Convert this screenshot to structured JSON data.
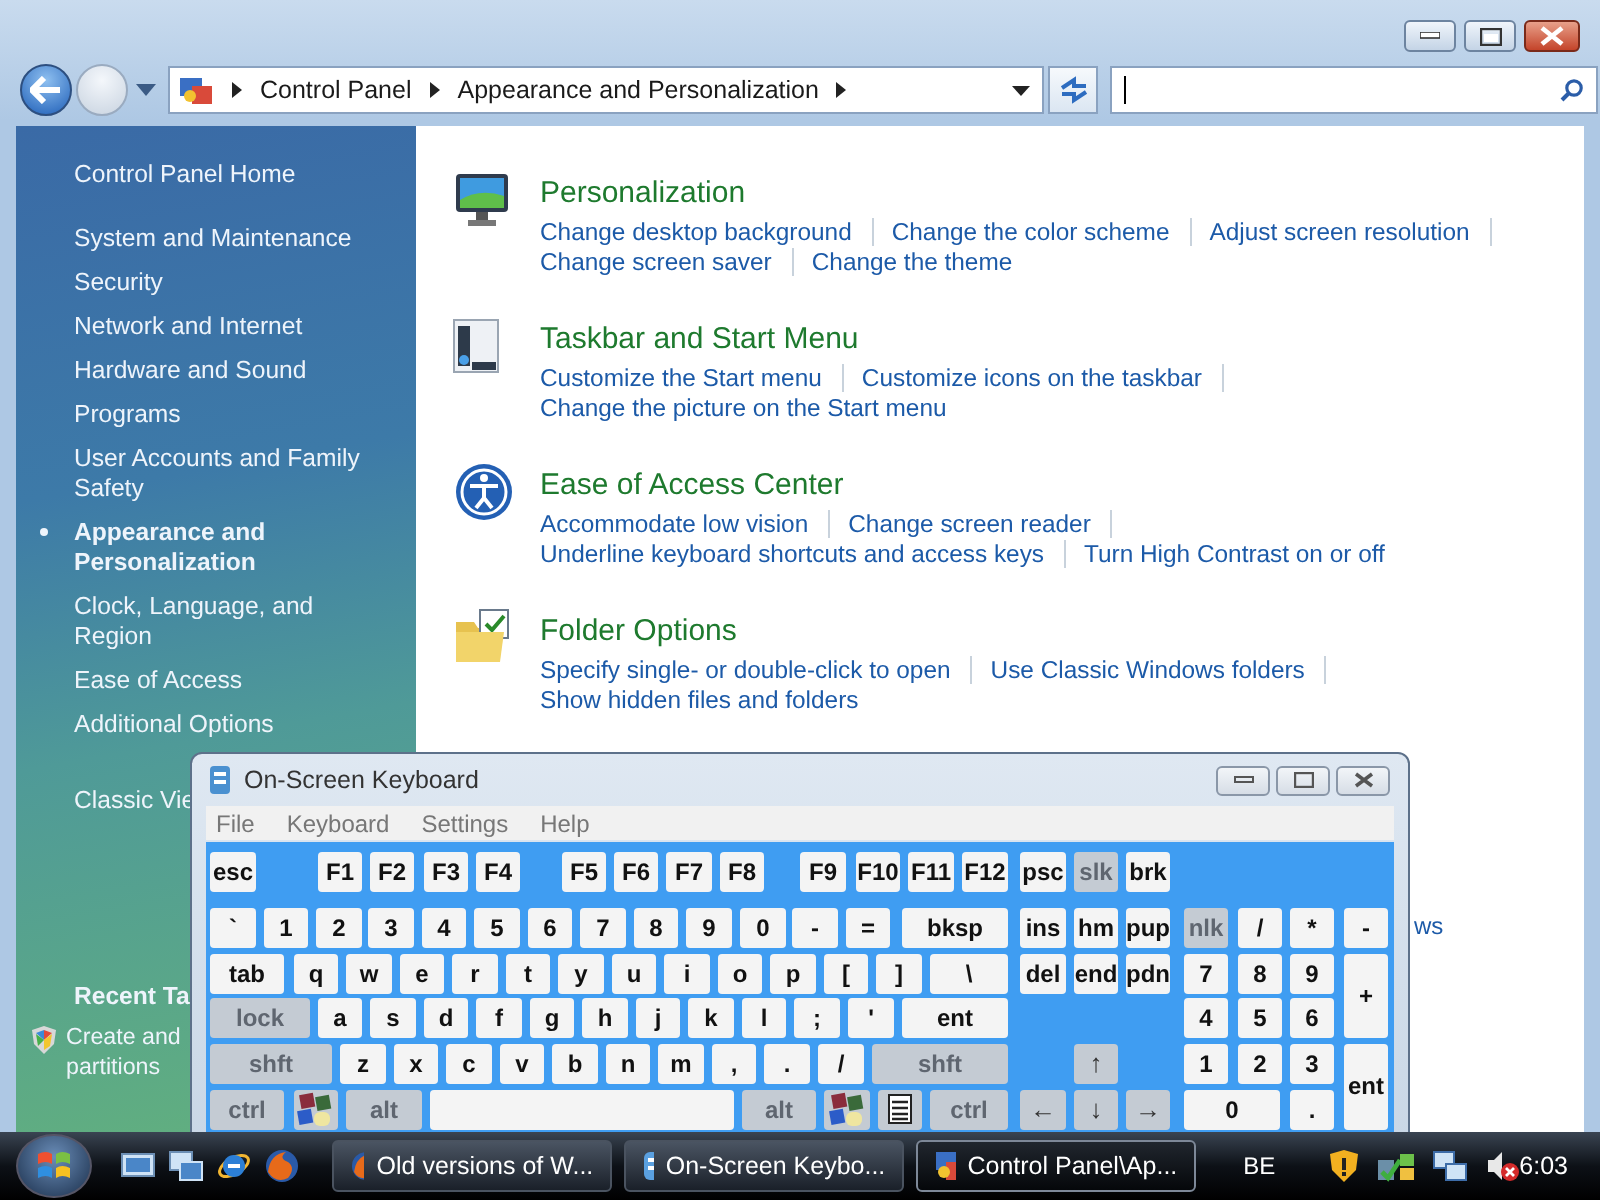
{
  "navigation": {
    "back": {
      "disabled": false
    },
    "forward": {
      "disabled": true
    }
  },
  "address_bar": {
    "crumbs": [
      "Control Panel",
      "Appearance and Personalization"
    ]
  },
  "sidebar": {
    "home": "Control Panel Home",
    "categories": [
      {
        "label": "System and Maintenance",
        "selected": false
      },
      {
        "label": "Security",
        "selected": false
      },
      {
        "label": "Network and Internet",
        "selected": false
      },
      {
        "label": "Hardware and Sound",
        "selected": false
      },
      {
        "label": "Programs",
        "selected": false
      },
      {
        "label": "User Accounts and Family Safety",
        "selected": false
      },
      {
        "label": "Appearance and Personalization",
        "selected": true
      },
      {
        "label": "Clock, Language, and Region",
        "selected": false
      },
      {
        "label": "Ease of Access",
        "selected": false
      },
      {
        "label": "Additional Options",
        "selected": false
      }
    ],
    "other_link": "Classic Vie",
    "recent_tasks": {
      "title": "Recent Ta",
      "items": [
        "Create and partitions"
      ]
    }
  },
  "categories": [
    {
      "title": "Personalization",
      "link_rows": [
        [
          "Change desktop background",
          "Change the color scheme",
          "Adjust screen resolution"
        ],
        [
          "Change screen saver",
          "Change the theme"
        ]
      ]
    },
    {
      "title": "Taskbar and Start Menu",
      "link_rows": [
        [
          "Customize the Start menu",
          "Customize icons on the taskbar"
        ],
        [
          "Change the picture on the Start menu"
        ]
      ]
    },
    {
      "title": "Ease of Access Center",
      "link_rows": [
        [
          "Accommodate low vision",
          "Change screen reader"
        ],
        [
          "Underline keyboard shortcuts and access keys",
          "Turn High Contrast on or off"
        ]
      ]
    },
    {
      "title": "Folder Options",
      "link_rows": [
        [
          "Specify single- or double-click to open",
          "Use Classic Windows folders"
        ],
        [
          "Show hidden files and folders"
        ]
      ]
    }
  ],
  "hidden_link_fragment": "ws",
  "keyboard": {
    "title": "On-Screen Keyboard",
    "menu": [
      "File",
      "Keyboard",
      "Settings",
      "Help"
    ],
    "rows": [
      {
        "keys": [
          {
            "label": "esc",
            "kind": "key"
          },
          {
            "label": "F1",
            "kind": "key"
          },
          {
            "label": "F2",
            "kind": "key"
          },
          {
            "label": "F3",
            "kind": "key"
          },
          {
            "label": "F4",
            "kind": "key"
          },
          {
            "label": "F5",
            "kind": "key"
          },
          {
            "label": "F6",
            "kind": "key"
          },
          {
            "label": "F7",
            "kind": "key"
          },
          {
            "label": "F8",
            "kind": "key"
          },
          {
            "label": "F9",
            "kind": "key"
          },
          {
            "label": "F10",
            "kind": "key"
          },
          {
            "label": "F11",
            "kind": "key"
          },
          {
            "label": "F12",
            "kind": "key"
          },
          {
            "label": "psc",
            "kind": "key"
          },
          {
            "label": "slk",
            "kind": "modifier"
          },
          {
            "label": "brk",
            "kind": "key"
          }
        ]
      },
      {
        "keys": [
          {
            "label": "`",
            "kind": "key"
          },
          {
            "label": "1",
            "kind": "key"
          },
          {
            "label": "2",
            "kind": "key"
          },
          {
            "label": "3",
            "kind": "key"
          },
          {
            "label": "4",
            "kind": "key"
          },
          {
            "label": "5",
            "kind": "key"
          },
          {
            "label": "6",
            "kind": "key"
          },
          {
            "label": "7",
            "kind": "key"
          },
          {
            "label": "8",
            "kind": "key"
          },
          {
            "label": "9",
            "kind": "key"
          },
          {
            "label": "0",
            "kind": "key"
          },
          {
            "label": "-",
            "kind": "key"
          },
          {
            "label": "=",
            "kind": "key"
          },
          {
            "label": "bksp",
            "kind": "key"
          },
          {
            "label": "ins",
            "kind": "key"
          },
          {
            "label": "hm",
            "kind": "key"
          },
          {
            "label": "pup",
            "kind": "key"
          },
          {
            "label": "nlk",
            "kind": "modifier"
          },
          {
            "label": "/",
            "kind": "key"
          },
          {
            "label": "*",
            "kind": "key"
          },
          {
            "label": "-",
            "kind": "key"
          }
        ]
      },
      {
        "keys": [
          {
            "label": "tab",
            "kind": "key"
          },
          {
            "label": "q",
            "kind": "key"
          },
          {
            "label": "w",
            "kind": "key"
          },
          {
            "label": "e",
            "kind": "key"
          },
          {
            "label": "r",
            "kind": "key"
          },
          {
            "label": "t",
            "kind": "key"
          },
          {
            "label": "y",
            "kind": "key"
          },
          {
            "label": "u",
            "kind": "key"
          },
          {
            "label": "i",
            "kind": "key"
          },
          {
            "label": "o",
            "kind": "key"
          },
          {
            "label": "p",
            "kind": "key"
          },
          {
            "label": "[",
            "kind": "key"
          },
          {
            "label": "]",
            "kind": "key"
          },
          {
            "label": "\\",
            "kind": "key"
          },
          {
            "label": "del",
            "kind": "key"
          },
          {
            "label": "end",
            "kind": "key"
          },
          {
            "label": "pdn",
            "kind": "key"
          },
          {
            "label": "7",
            "kind": "key"
          },
          {
            "label": "8",
            "kind": "key"
          },
          {
            "label": "9",
            "kind": "key"
          },
          {
            "label": "+",
            "kind": "key"
          }
        ]
      },
      {
        "keys": [
          {
            "label": "lock",
            "kind": "modifier"
          },
          {
            "label": "a",
            "kind": "key"
          },
          {
            "label": "s",
            "kind": "key"
          },
          {
            "label": "d",
            "kind": "key"
          },
          {
            "label": "f",
            "kind": "key"
          },
          {
            "label": "g",
            "kind": "key"
          },
          {
            "label": "h",
            "kind": "key"
          },
          {
            "label": "j",
            "kind": "key"
          },
          {
            "label": "k",
            "kind": "key"
          },
          {
            "label": "l",
            "kind": "key"
          },
          {
            "label": ";",
            "kind": "key"
          },
          {
            "label": "'",
            "kind": "key"
          },
          {
            "label": "ent",
            "kind": "key"
          },
          {
            "label": "4",
            "kind": "key"
          },
          {
            "label": "5",
            "kind": "key"
          },
          {
            "label": "6",
            "kind": "key"
          }
        ]
      },
      {
        "keys": [
          {
            "label": "shft",
            "kind": "modifier"
          },
          {
            "label": "z",
            "kind": "key"
          },
          {
            "label": "x",
            "kind": "key"
          },
          {
            "label": "c",
            "kind": "key"
          },
          {
            "label": "v",
            "kind": "key"
          },
          {
            "label": "b",
            "kind": "key"
          },
          {
            "label": "n",
            "kind": "key"
          },
          {
            "label": "m",
            "kind": "key"
          },
          {
            "label": ",",
            "kind": "key"
          },
          {
            "label": ".",
            "kind": "key"
          },
          {
            "label": "/",
            "kind": "key"
          },
          {
            "label": "shft",
            "kind": "modifier"
          },
          {
            "label": "↑",
            "kind": "arrow"
          },
          {
            "label": "1",
            "kind": "key"
          },
          {
            "label": "2",
            "kind": "key"
          },
          {
            "label": "3",
            "kind": "key"
          },
          {
            "label": "ent",
            "kind": "key"
          }
        ]
      },
      {
        "keys": [
          {
            "label": "ctrl",
            "kind": "modifier"
          },
          {
            "kind": "windows"
          },
          {
            "label": "alt",
            "kind": "modifier"
          },
          {
            "kind": "space"
          },
          {
            "label": "alt",
            "kind": "modifier"
          },
          {
            "kind": "windows"
          },
          {
            "kind": "menu"
          },
          {
            "label": "ctrl",
            "kind": "modifier"
          },
          {
            "label": "←",
            "kind": "arrow"
          },
          {
            "label": "↓",
            "kind": "arrow"
          },
          {
            "label": "→",
            "kind": "arrow"
          },
          {
            "label": "0",
            "kind": "key"
          },
          {
            "label": ".",
            "kind": "key"
          }
        ]
      }
    ]
  },
  "taskbar": {
    "tasks": [
      {
        "label": "Old versions of W...",
        "selected": false
      },
      {
        "label": "On-Screen Keybo...",
        "selected": false
      },
      {
        "label": "Control Panel\\Ap...",
        "selected": true
      }
    ],
    "language": "BE",
    "clock": "6:03"
  }
}
